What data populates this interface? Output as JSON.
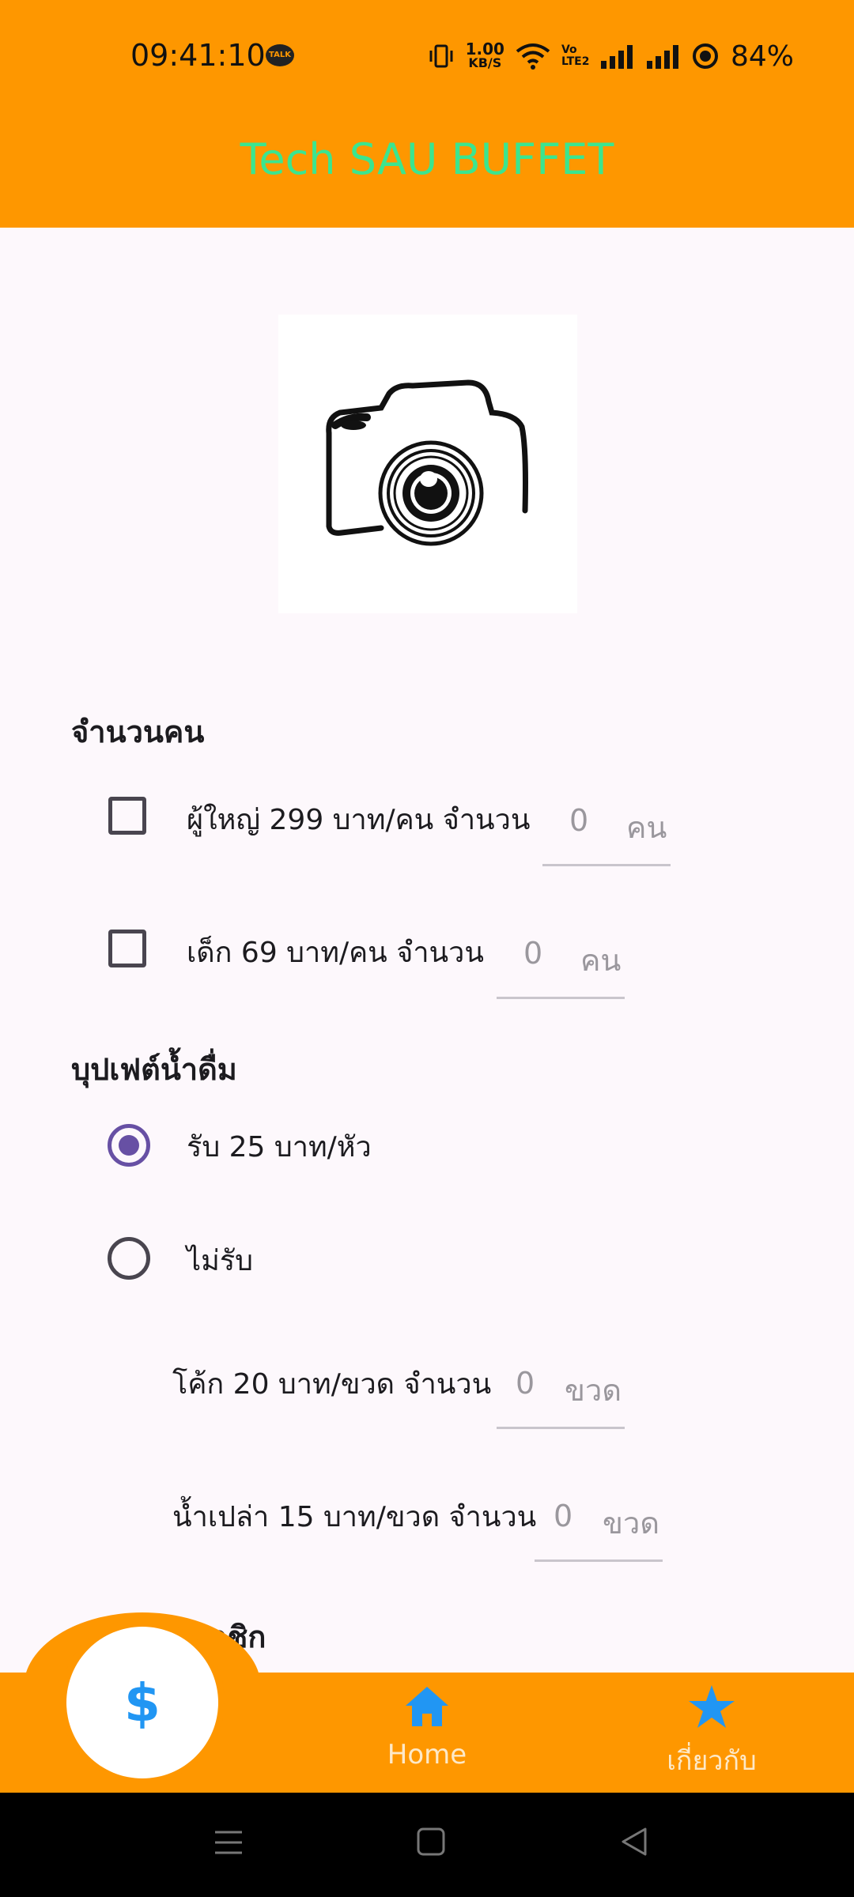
{
  "status_bar": {
    "time": "09:41:10",
    "talk_badge": "TALK",
    "net_speed_value": "1.00",
    "net_speed_unit": "KB/S",
    "volte": "Vo LTE2",
    "battery": "84%"
  },
  "app_bar": {
    "title": "Tech SAU BUFFET"
  },
  "photo": {
    "icon": "camera-icon"
  },
  "people": {
    "title": "จำนวนคน",
    "adult": {
      "label": "ผู้ใหญ่ 299 บาท/คน จำนวน",
      "value": "0",
      "unit": "คน",
      "checked": false
    },
    "child": {
      "label": "เด็ก 69 บาท/คน จำนวน",
      "value": "0",
      "unit": "คน",
      "checked": false
    }
  },
  "drinks": {
    "title": "บุปเฟต์น้ำดื่ม",
    "options": [
      {
        "label": "รับ 25 บาท/หัว",
        "selected": true
      },
      {
        "label": "ไม่รับ",
        "selected": false
      }
    ],
    "coke": {
      "label": "โค้ก 20 บาท/ขวด จำนวน",
      "value": "0",
      "unit": "ขวด"
    },
    "water": {
      "label": "น้ำเปล่า 15 บาท/ขวด จำนวน",
      "value": "0",
      "unit": "ขวด"
    }
  },
  "membership": {
    "title": "ประเภทสมาชิก"
  },
  "bottom_nav": {
    "fab_icon": "dollar-icon",
    "fab_symbol": "$",
    "items": [
      {
        "label": "Home",
        "icon": "home-icon"
      },
      {
        "label": "เกี่ยวกับ",
        "icon": "star-icon"
      }
    ]
  },
  "colors": {
    "primary": "#fe9700",
    "title_text": "#3be58f",
    "accent": "#6750a4",
    "nav_icon": "#2196f3"
  }
}
